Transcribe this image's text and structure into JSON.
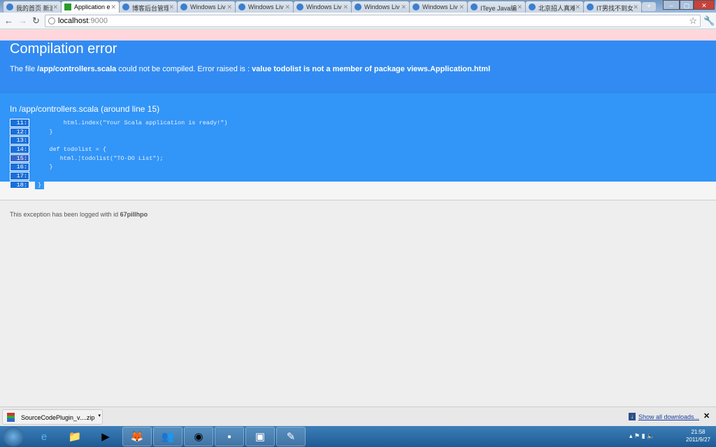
{
  "browser": {
    "tabs": [
      {
        "label": "我的首页 新浪",
        "icon": "weibo-icon"
      },
      {
        "label": "Application e",
        "icon": "play-icon",
        "active": true
      },
      {
        "label": "博客后台管理",
        "icon": "windows-live-icon"
      },
      {
        "label": "Windows Liv",
        "icon": "windows-live-icon"
      },
      {
        "label": "Windows Liv",
        "icon": "windows-live-icon"
      },
      {
        "label": "Windows Liv",
        "icon": "windows-live-icon"
      },
      {
        "label": "Windows Liv",
        "icon": "windows-live-green-icon"
      },
      {
        "label": "Windows Liv",
        "icon": "windows-flag-icon"
      },
      {
        "label": "ITeye Java编",
        "icon": "iteye-icon"
      },
      {
        "label": "北京招人真难",
        "icon": "iteye-icon"
      },
      {
        "label": "IT男找不到女",
        "icon": "iteye-icon"
      }
    ],
    "new_tab": "+",
    "address": {
      "host": "localhost",
      "port": ":9000"
    }
  },
  "page": {
    "title": "Compilation error",
    "desc_prefix": "The file ",
    "desc_file": "/app/controllers.scala",
    "desc_middle": " could not be compiled. Error raised is : ",
    "desc_error": "value todolist is not a member of package views.Application.html",
    "source_heading": "In /app/controllers.scala (around line 15)",
    "code": [
      {
        "line": "11:",
        "text": "        html.index(\"Your Scala application is ready!\")"
      },
      {
        "line": "12:",
        "text": "    }"
      },
      {
        "line": "13:",
        "text": ""
      },
      {
        "line": "14:",
        "text": "    def todolist = {"
      },
      {
        "line": "15:",
        "text": "       html.¦todolist(\"TO-DO List\");",
        "highlight": true
      },
      {
        "line": "16:",
        "text": "    }"
      },
      {
        "line": "17:",
        "text": ""
      },
      {
        "line": "18:",
        "text": "}"
      }
    ],
    "footer_prefix": "This exception has been logged with id ",
    "footer_id": "67pillhpo"
  },
  "downloads": {
    "file": "SourceCodePlugin_v....zip",
    "show_all": "Show all downloads...",
    "close": "✕"
  },
  "taskbar": {
    "time": "21:58",
    "date": "2011/9/27"
  }
}
